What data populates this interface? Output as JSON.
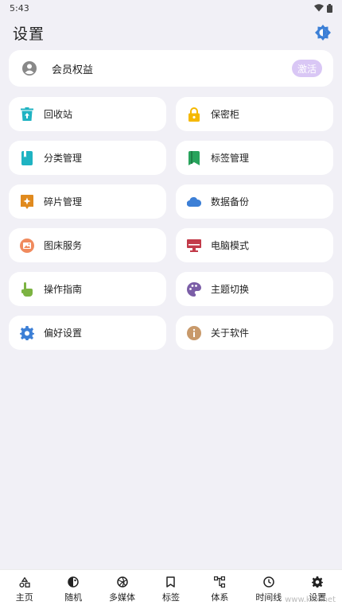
{
  "status": {
    "time": "5:43"
  },
  "header": {
    "title": "设置"
  },
  "member": {
    "label": "会员权益",
    "action": "激活"
  },
  "tiles": [
    {
      "label": "回收站",
      "icon": "trash-icon",
      "color": "#1fb3c2"
    },
    {
      "label": "保密柜",
      "icon": "lock-icon",
      "color": "#f5b800"
    },
    {
      "label": "分类管理",
      "icon": "book-icon",
      "color": "#1fb3c2"
    },
    {
      "label": "标签管理",
      "icon": "bookmark-icon",
      "color": "#28a35c"
    },
    {
      "label": "碎片管理",
      "icon": "fragment-icon",
      "color": "#e08a1e"
    },
    {
      "label": "数据备份",
      "icon": "cloud-icon",
      "color": "#3c7fd6"
    },
    {
      "label": "图床服务",
      "icon": "image-icon",
      "color": "#f08a5d"
    },
    {
      "label": "电脑模式",
      "icon": "desktop-icon",
      "color": "#c23b4a"
    },
    {
      "label": "操作指南",
      "icon": "hand-pointer-icon",
      "color": "#7cb342"
    },
    {
      "label": "主题切换",
      "icon": "palette-icon",
      "color": "#7b5ea7"
    },
    {
      "label": "偏好设置",
      "icon": "gear-icon",
      "color": "#3c7fd6"
    },
    {
      "label": "关于软件",
      "icon": "info-icon",
      "color": "#c8996a"
    }
  ],
  "nav": [
    {
      "label": "主页",
      "icon": "home-shapes-icon"
    },
    {
      "label": "随机",
      "icon": "random-icon"
    },
    {
      "label": "多媒体",
      "icon": "aperture-icon"
    },
    {
      "label": "标签",
      "icon": "bookmark-outline-icon"
    },
    {
      "label": "体系",
      "icon": "hierarchy-icon"
    },
    {
      "label": "时间线",
      "icon": "clock-icon"
    },
    {
      "label": "设置",
      "icon": "settings-icon"
    }
  ],
  "watermark": "www.kkx.net",
  "colors": {
    "accent": "#3c7fd6",
    "activate": "#d9c7f5",
    "background": "#f1f0f6"
  }
}
